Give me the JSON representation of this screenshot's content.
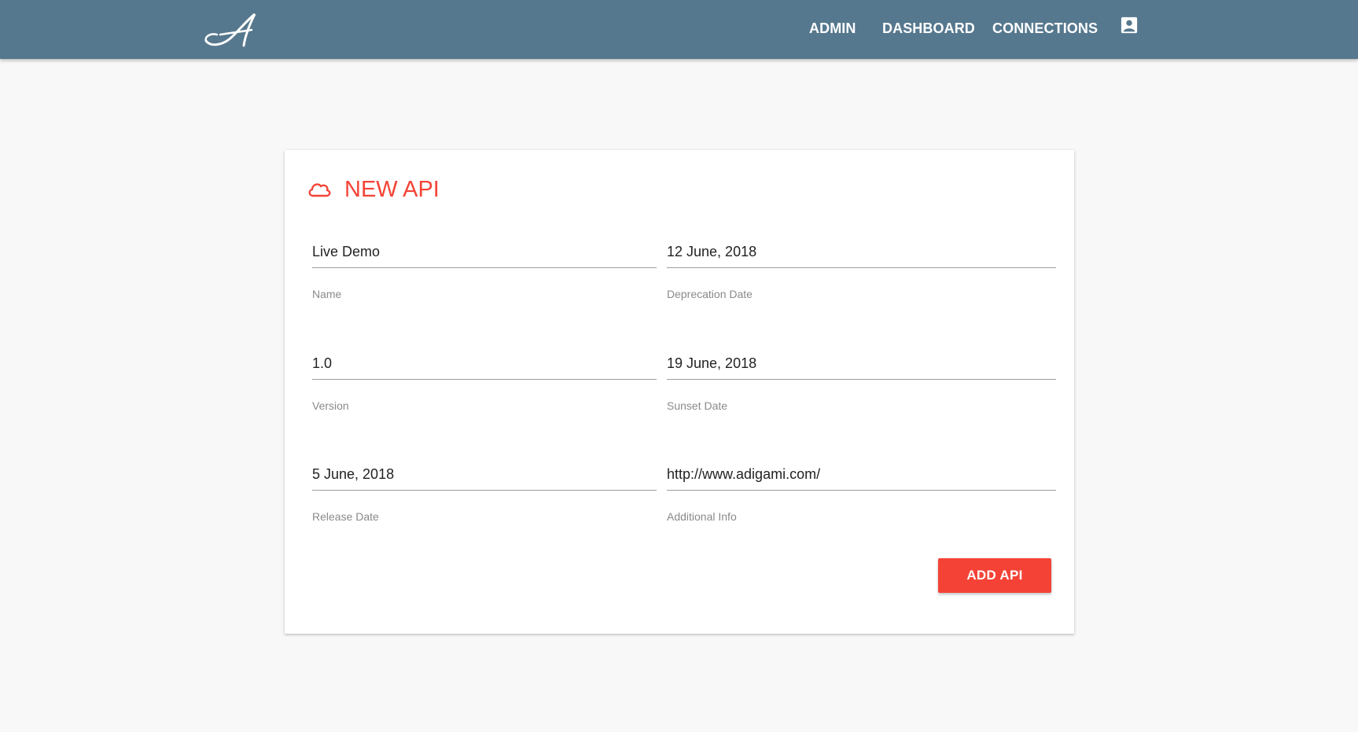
{
  "header": {
    "logo_icon": "script-a-logo",
    "nav": {
      "admin": "ADMIN",
      "dashboard": "DASHBOARD",
      "connections": "CONNECTIONS"
    },
    "account_icon": "account-box-icon",
    "background_color": "#56788e"
  },
  "form": {
    "icon": "cloud-icon",
    "title": "NEW API",
    "accent_color": "#f44336",
    "fields": {
      "name": {
        "value": "Live Demo",
        "label": "Name"
      },
      "deprecation_date": {
        "value": "12 June, 2018",
        "label": "Deprecation Date"
      },
      "version": {
        "value": "1.0",
        "label": "Version"
      },
      "sunset_date": {
        "value": "19 June, 2018",
        "label": "Sunset Date"
      },
      "release_date": {
        "value": "5 June, 2018",
        "label": "Release Date"
      },
      "additional_info": {
        "value": "http://www.adigami.com/",
        "label": "Additional Info"
      }
    },
    "submit_label": "ADD API"
  }
}
